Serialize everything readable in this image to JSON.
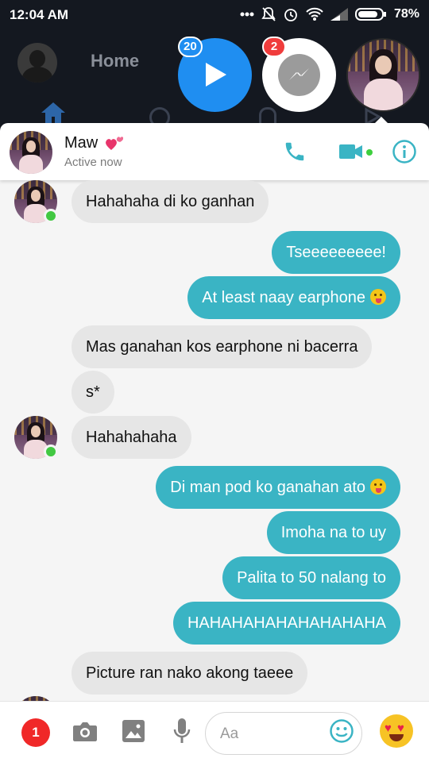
{
  "status_bar": {
    "time": "12:04 AM",
    "battery_pct": "78%"
  },
  "top_area": {
    "home_label": "Home",
    "video_badge": "20",
    "messenger_badge": "2"
  },
  "chat_header": {
    "name": "Maw",
    "status": "Active now",
    "accent_color": "#3ab4c4"
  },
  "messages": [
    {
      "from": "them",
      "text": "Hahahaha di ko ganhan"
    },
    {
      "from": "me",
      "text": "Tseeeeeeeee!"
    },
    {
      "from": "me",
      "text": "At least naay earphone"
    },
    {
      "from": "them",
      "text": "Mas ganahan kos earphone ni bacerra"
    },
    {
      "from": "them",
      "text": "s*"
    },
    {
      "from": "them",
      "text": "Hahahahaha"
    },
    {
      "from": "me",
      "text": "Di man pod ko ganahan ato"
    },
    {
      "from": "me",
      "text": "Imoha na to uy"
    },
    {
      "from": "me",
      "text": "Palita to 50 nalang to"
    },
    {
      "from": "me",
      "text": "HAHAHAHAHAHAHAHAHA"
    },
    {
      "from": "them",
      "text": "Picture ran nako akong taeee"
    }
  ],
  "composer": {
    "badge_count": "1",
    "placeholder": "Aa"
  }
}
